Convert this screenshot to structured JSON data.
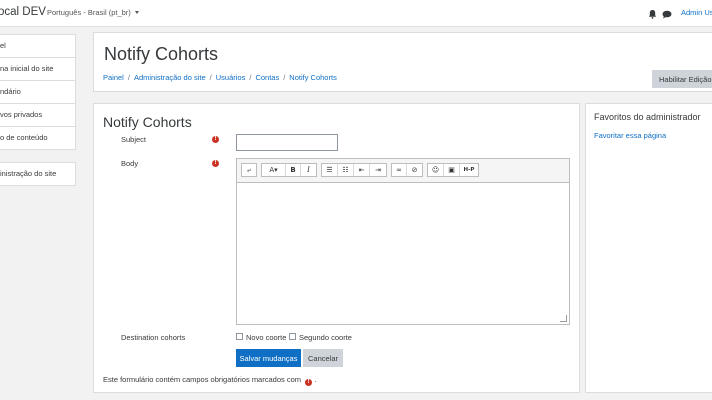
{
  "navbar": {
    "brand": "ocal DEV",
    "language": "Português - Brasil (pt_br)",
    "user": "Admin Us"
  },
  "drawer": {
    "items": [
      "el",
      "na inicial do site",
      "ndário",
      "vos privados",
      "o de conteúdo"
    ],
    "admin_item": "inistração do site"
  },
  "header": {
    "title": "Notify Cohorts",
    "breadcrumb": [
      "Painel",
      "Administração do site",
      "Usuários",
      "Contas",
      "Notify Cohorts"
    ],
    "edit_button": "Habilitar Edição c"
  },
  "form": {
    "title": "Notify Cohorts",
    "subject_label": "Subject",
    "subject_value": "",
    "body_label": "Body",
    "destination_label": "Destination cohorts",
    "cohorts": [
      "Novo coorte",
      "Segundo coorte"
    ],
    "save_button": "Salvar mudanças",
    "cancel_button": "Cancelar",
    "required_note": "Este formulário contém campos obrigatórios marcados com",
    "required_note_end": "."
  },
  "toolbar": {
    "buttons": [
      "undo-icon",
      "font-color-icon",
      "bold-icon",
      "italic-icon",
      "unordered-list-icon",
      "ordered-list-icon",
      "outdent-icon",
      "indent-icon",
      "link-icon",
      "unlink-icon",
      "emoji-icon",
      "image-icon",
      "h5p-icon"
    ],
    "bold": "B",
    "italic": "I",
    "font": "A",
    "h5p": "H-P"
  },
  "sidebar_block": {
    "title": "Favoritos do administrador",
    "link": "Favoritar essa página"
  },
  "colors": {
    "link": "#0f6fc5",
    "primary": "#0f6fc5",
    "required": "#ca3120",
    "background": "#f2f2f2"
  }
}
